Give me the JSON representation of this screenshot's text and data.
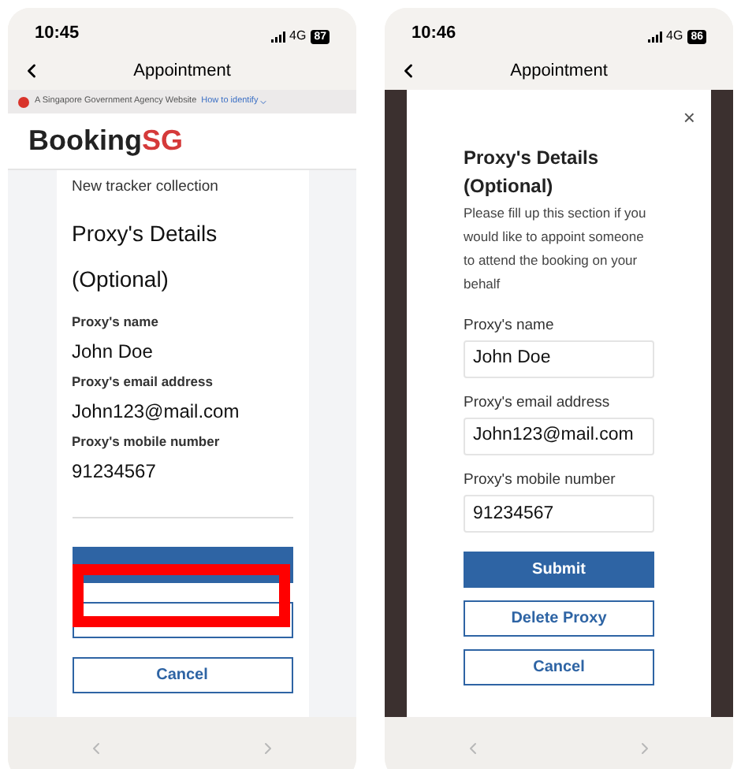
{
  "screens": [
    {
      "kind": "form",
      "status_bar": {
        "time": "10:45",
        "network": "4G",
        "battery": "87"
      },
      "nav": {
        "title": "Appointment"
      },
      "banner": {
        "text": "A Singapore Government Agency Website",
        "link": "How to identify"
      },
      "brand": {
        "name": "Booking",
        "accent": "SG"
      },
      "subtitle": "New tracker collection",
      "heading": "Proxy's Details",
      "heading_note": "(Optional)",
      "fields": [
        {
          "label": "Proxy's name",
          "value": "John Doe"
        },
        {
          "label": "Proxy's email address",
          "value": "John123@mail.com"
        },
        {
          "label": "Proxy's mobile number",
          "value": "91234567"
        }
      ],
      "buttons": [
        {
          "kind": "primary"
        },
        {
          "kind": "outline"
        },
        {
          "kind": "outline",
          "label": "Cancel"
        }
      ],
      "highlight": true
    },
    {
      "kind": "modal",
      "status_bar": {
        "time": "10:46",
        "network": "4G",
        "battery": "86"
      },
      "nav": {
        "title": "Appointment"
      },
      "close": "×",
      "heading": "Proxy's Details",
      "heading_note": "(Optional)",
      "description": "Please fill up this section if you would like to appoint someone to attend the booking on your behalf",
      "fields": [
        {
          "label": "Proxy's name",
          "value": "John Doe"
        },
        {
          "label": "Proxy's email address",
          "value": "John123@mail.com"
        },
        {
          "label": "Proxy's mobile number",
          "value": "91234567"
        }
      ],
      "buttons": [
        {
          "kind": "primary",
          "label": "Submit"
        },
        {
          "kind": "outline",
          "label": "Delete Proxy"
        },
        {
          "kind": "outline",
          "label": "Cancel"
        }
      ]
    }
  ]
}
